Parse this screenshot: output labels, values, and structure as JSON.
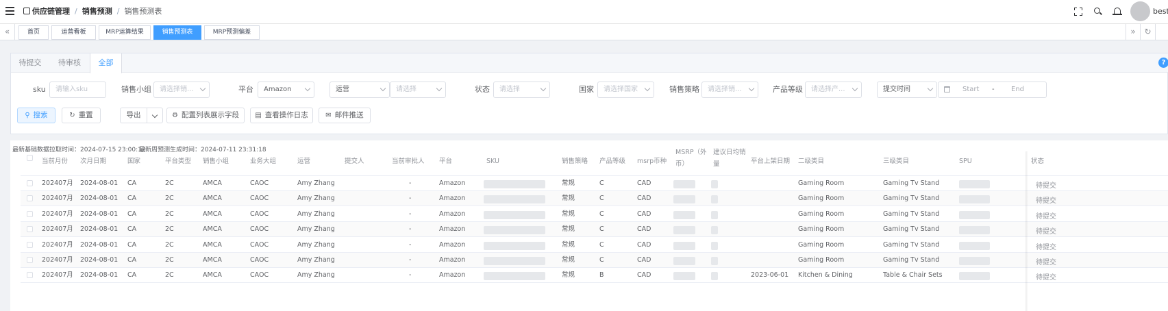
{
  "navbar": {
    "breadcrumbs": [
      "供应链管理",
      "销售预测",
      "销售预测表"
    ],
    "username": "besti"
  },
  "tags": {
    "prev_arrow": "«",
    "next_arrow": "»",
    "refresh": "↻",
    "items": [
      "首页",
      "运营看板",
      "MRP运算结果",
      "销售预测表",
      "MRP预测偏差"
    ]
  },
  "tabs": [
    "待提交",
    "待审核",
    "全部"
  ],
  "help": "?",
  "filters": {
    "sku_label": "sku",
    "sku_placeholder": "请输入sku",
    "group_label": "销售小组",
    "group_placeholder": "请选择销...",
    "platform_label": "平台",
    "platform_value": "Amazon",
    "operator_value": "运营",
    "operator_placeholder": "请选择",
    "status_label": "状态",
    "status_placeholder": "请选择",
    "country_label": "国家",
    "country_placeholder": "请选择国家",
    "strategy_label": "销售策略",
    "strategy_placeholder": "请选择销...",
    "grade_label": "产品等级",
    "grade_placeholder": "请选择产...",
    "time_value": "提交时间",
    "start_placeholder": "Start",
    "range_sep": "-",
    "end_placeholder": "End"
  },
  "buttons": {
    "search": "搜索",
    "reset": "重置",
    "export": "导出",
    "config": "配置列表展示字段",
    "log": "查看操作日志",
    "mail": "邮件推送"
  },
  "info": {
    "pull_time": "最新基础数据拉取时间：2024-07-15 23:00:12",
    "gen_time": "最新周预测生成时间：2024-07-11 23:31:18"
  },
  "table": {
    "headers": [
      "当前月份",
      "次月日期",
      "国家",
      "平台类型",
      "销售小组",
      "业务大组",
      "运营",
      "提交人",
      "当前审批人",
      "平台",
      "SKU",
      "销售策略",
      "产品等级",
      "msrp币种",
      "MSRP（外币）",
      "建议日均销量",
      "平台上架日期",
      "二级类目",
      "三级类目",
      "SPU",
      "状态"
    ],
    "rows": [
      {
        "month": "202407月",
        "next": "2024-08-01",
        "country": "CA",
        "ptype": "2C",
        "group": "AMCA",
        "biz": "CAOC",
        "op": "Amy Zhang",
        "approver": "-",
        "platform": "Amazon",
        "strategy": "常规",
        "grade": "C",
        "cur": "CAD",
        "listdate": "",
        "cat2": "Gaming Room",
        "cat3": "Gaming Tv Stand",
        "status": "待提交"
      },
      {
        "month": "202407月",
        "next": "2024-08-01",
        "country": "CA",
        "ptype": "2C",
        "group": "AMCA",
        "biz": "CAOC",
        "op": "Amy Zhang",
        "approver": "-",
        "platform": "Amazon",
        "strategy": "常规",
        "grade": "C",
        "cur": "CAD",
        "listdate": "",
        "cat2": "Gaming Room",
        "cat3": "Gaming Tv Stand",
        "status": "待提交"
      },
      {
        "month": "202407月",
        "next": "2024-08-01",
        "country": "CA",
        "ptype": "2C",
        "group": "AMCA",
        "biz": "CAOC",
        "op": "Amy Zhang",
        "approver": "-",
        "platform": "Amazon",
        "strategy": "常规",
        "grade": "C",
        "cur": "CAD",
        "listdate": "",
        "cat2": "Gaming Room",
        "cat3": "Gaming Tv Stand",
        "status": "待提交"
      },
      {
        "month": "202407月",
        "next": "2024-08-01",
        "country": "CA",
        "ptype": "2C",
        "group": "AMCA",
        "biz": "CAOC",
        "op": "Amy Zhang",
        "approver": "-",
        "platform": "Amazon",
        "strategy": "常规",
        "grade": "C",
        "cur": "CAD",
        "listdate": "",
        "cat2": "Gaming Room",
        "cat3": "Gaming Tv Stand",
        "status": "待提交"
      },
      {
        "month": "202407月",
        "next": "2024-08-01",
        "country": "CA",
        "ptype": "2C",
        "group": "AMCA",
        "biz": "CAOC",
        "op": "Amy Zhang",
        "approver": "-",
        "platform": "Amazon",
        "strategy": "常规",
        "grade": "C",
        "cur": "CAD",
        "listdate": "",
        "cat2": "Gaming Room",
        "cat3": "Gaming Tv Stand",
        "status": "待提交"
      },
      {
        "month": "202407月",
        "next": "2024-08-01",
        "country": "CA",
        "ptype": "2C",
        "group": "AMCA",
        "biz": "CAOC",
        "op": "Amy Zhang",
        "approver": "-",
        "platform": "Amazon",
        "strategy": "常规",
        "grade": "C",
        "cur": "CAD",
        "listdate": "",
        "cat2": "Gaming Room",
        "cat3": "Gaming Tv Stand",
        "status": "待提交"
      },
      {
        "month": "202407月",
        "next": "2024-08-01",
        "country": "CA",
        "ptype": "2C",
        "group": "AMCA",
        "biz": "CAOC",
        "op": "Amy Zhang",
        "approver": "-",
        "platform": "Amazon",
        "strategy": "常规",
        "grade": "B",
        "cur": "CAD",
        "listdate": "2023-06-01",
        "cat2": "Kitchen & Dining",
        "cat3": "Table & Chair Sets",
        "status": "待提交"
      }
    ]
  },
  "colors": {
    "accent": "#409eff",
    "border": "#dcdfe6",
    "text": "#606266"
  }
}
